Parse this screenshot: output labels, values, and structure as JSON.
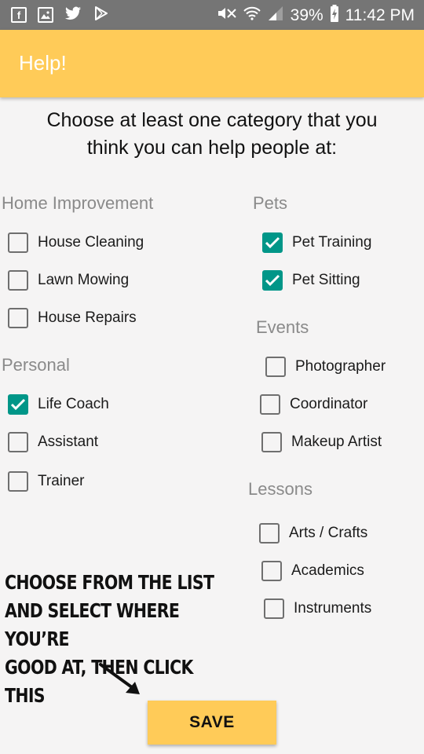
{
  "status_bar": {
    "battery": "39%",
    "time": "11:42 PM",
    "left_icons": [
      "facebook-icon",
      "gallery-icon",
      "twitter-icon",
      "play-store-icon"
    ],
    "right_icons": [
      "mute-icon",
      "wifi-icon",
      "signal-icon",
      "battery-charging-icon"
    ]
  },
  "app_bar": {
    "title": "Help!",
    "background": "#ffcb58"
  },
  "instructions": "Choose at least one category that you\nthink you can help people at:",
  "sections": {
    "home_improvement": {
      "title": "Home Improvement",
      "options": [
        {
          "label": "House Cleaning",
          "checked": false
        },
        {
          "label": "Lawn Mowing",
          "checked": false
        },
        {
          "label": "House Repairs",
          "checked": false
        }
      ]
    },
    "personal": {
      "title": "Personal",
      "options": [
        {
          "label": "Life Coach",
          "checked": true
        },
        {
          "label": "Assistant",
          "checked": false
        },
        {
          "label": "Trainer",
          "checked": false
        }
      ]
    },
    "pets": {
      "title": "Pets",
      "options": [
        {
          "label": "Pet Training",
          "checked": true
        },
        {
          "label": "Pet Sitting",
          "checked": true
        }
      ]
    },
    "events": {
      "title": "Events",
      "options": [
        {
          "label": "Photographer",
          "checked": false
        },
        {
          "label": "Coordinator",
          "checked": false
        },
        {
          "label": "Makeup Artist",
          "checked": false
        }
      ]
    },
    "lessons": {
      "title": "Lessons",
      "options": [
        {
          "label": "Arts / Crafts",
          "checked": false
        },
        {
          "label": "Academics",
          "checked": false
        },
        {
          "label": "Instruments",
          "checked": false
        }
      ]
    }
  },
  "hint": "CHOOSE FROM THE LIST\nAND SELECT WHERE YOU’RE\nGOOD AT, THEN CLICK THIS",
  "save_button": {
    "label": "SAVE"
  },
  "colors": {
    "accent": "#ffcb58",
    "checkbox_checked": "#009688",
    "status_bar": "#757575"
  }
}
